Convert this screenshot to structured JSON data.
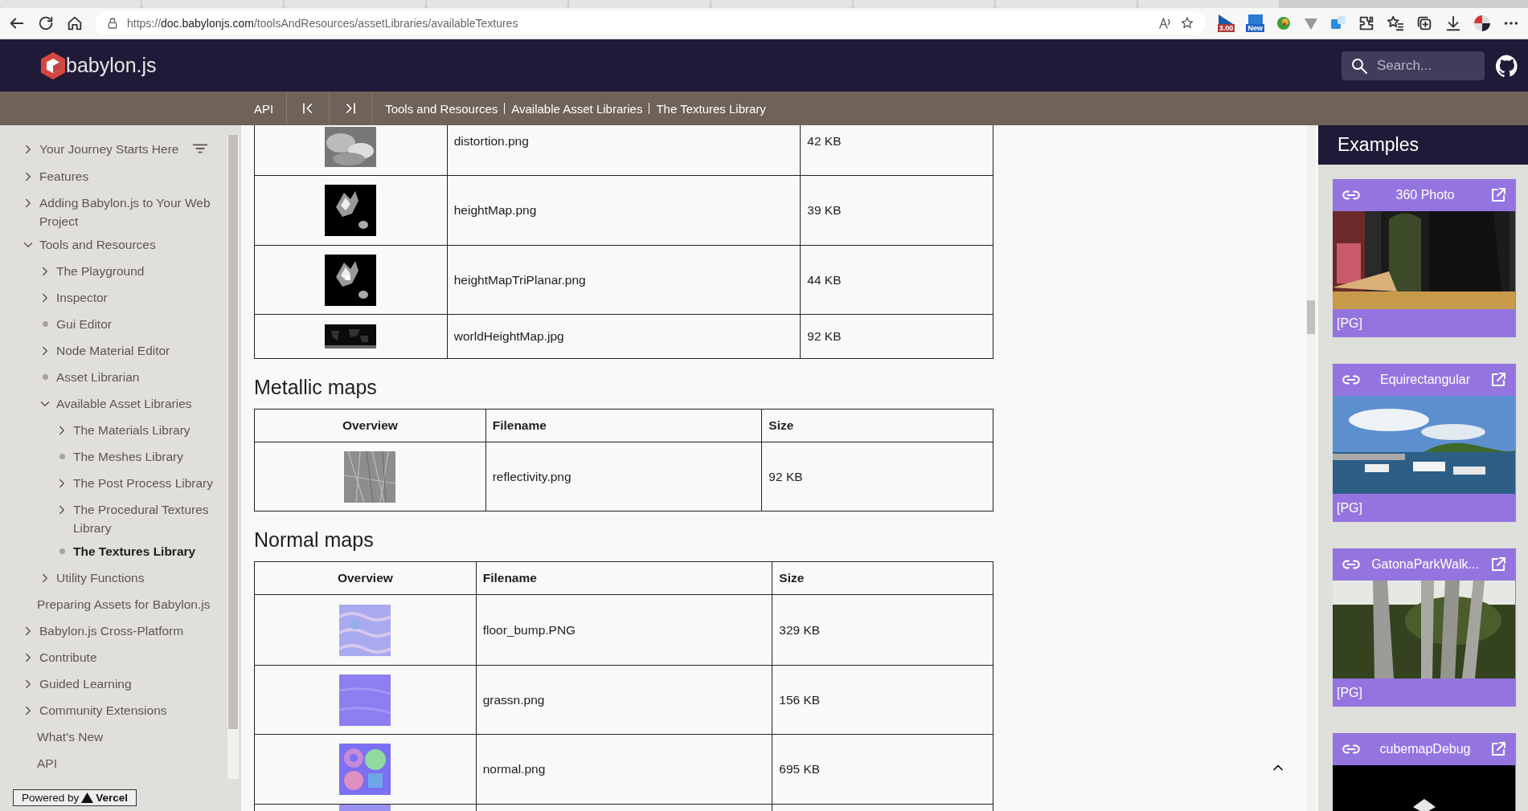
{
  "browser": {
    "url": "https://doc.babylonjs.com/toolsAndResources/assetLibraries/availableTextures",
    "extension_badges": [
      "3.00",
      "New"
    ]
  },
  "header": {
    "logo": "babylon.js",
    "search": {
      "placeholder": "Search..."
    }
  },
  "nav": {
    "api": "API",
    "breadcrumbs": [
      "Tools and Resources",
      "Available Asset Libraries",
      "The Textures Library"
    ]
  },
  "sidebar": {
    "items": [
      {
        "label": "Your Journey Starts Here",
        "kind": "folder",
        "expanded": false,
        "selected": false
      },
      {
        "label": "Features",
        "kind": "folder",
        "expanded": false,
        "selected": false
      },
      {
        "label": "Adding Babylon.js to Your Web Project",
        "kind": "folder",
        "expanded": false,
        "selected": false
      },
      {
        "label": "Tools and Resources",
        "kind": "folder",
        "expanded": true,
        "selected": false,
        "children": [
          {
            "label": "The Playground",
            "kind": "folder",
            "expanded": false,
            "selected": false
          },
          {
            "label": "Inspector",
            "kind": "folder",
            "expanded": false,
            "selected": false
          },
          {
            "label": "Gui Editor",
            "kind": "page",
            "selected": false
          },
          {
            "label": "Node Material Editor",
            "kind": "folder",
            "expanded": false,
            "selected": false
          },
          {
            "label": "Asset Librarian",
            "kind": "page",
            "selected": false
          },
          {
            "label": "Available Asset Libraries",
            "kind": "folder",
            "expanded": true,
            "selected": false,
            "children": [
              {
                "label": "The Materials Library",
                "kind": "folder",
                "expanded": false,
                "selected": false
              },
              {
                "label": "The Meshes Library",
                "kind": "page",
                "selected": false
              },
              {
                "label": "The Post Process Library",
                "kind": "folder",
                "expanded": false,
                "selected": false
              },
              {
                "label": "The Procedural Textures Library",
                "kind": "folder",
                "expanded": false,
                "selected": false
              },
              {
                "label": "The Textures Library",
                "kind": "page",
                "selected": true
              }
            ]
          },
          {
            "label": "Utility Functions",
            "kind": "folder",
            "expanded": false,
            "selected": false
          }
        ]
      },
      {
        "label": "Preparing Assets for Babylon.js",
        "kind": "plain",
        "selected": false
      },
      {
        "label": "Babylon.js Cross-Platform",
        "kind": "folder",
        "expanded": false,
        "selected": false
      },
      {
        "label": "Contribute",
        "kind": "folder",
        "expanded": false,
        "selected": false
      },
      {
        "label": "Guided Learning",
        "kind": "folder",
        "expanded": false,
        "selected": false
      },
      {
        "label": "Community Extensions",
        "kind": "folder",
        "expanded": false,
        "selected": false
      },
      {
        "label": "What's New",
        "kind": "plain",
        "selected": false
      },
      {
        "label": "API",
        "kind": "plain",
        "selected": false
      }
    ],
    "powered_by": {
      "text": "Powered by",
      "brand": "Vercel"
    }
  },
  "content": {
    "sections": [
      {
        "rows": [
          {
            "kind": "picture",
            "filename": "distortion.png",
            "size": "42 KB"
          },
          {
            "kind": "picture",
            "filename": "heightMap.png",
            "size": "39 KB"
          },
          {
            "kind": "picture",
            "filename": "heightMapTriPlanar.png",
            "size": "44 KB"
          },
          {
            "kind": "picture",
            "filename": "worldHeightMap.jpg",
            "size": "92 KB"
          }
        ]
      },
      {
        "heading": "Metallic maps",
        "columns": [
          "Overview",
          "Filename",
          "Size"
        ],
        "rows": [
          {
            "kind": "picture",
            "filename": "reflectivity.png",
            "size": "92 KB"
          }
        ]
      },
      {
        "heading": "Normal maps",
        "columns": [
          "Overview",
          "Filename",
          "Size"
        ],
        "rows": [
          {
            "kind": "picture",
            "filename": "floor_bump.PNG",
            "size": "329 KB"
          },
          {
            "kind": "picture",
            "filename": "grassn.png",
            "size": "156 KB"
          },
          {
            "kind": "picture",
            "filename": "normal.png",
            "size": "695 KB"
          },
          {
            "kind": "picture"
          }
        ]
      }
    ]
  },
  "examples": {
    "title": "Examples",
    "cards": [
      {
        "title": "360 Photo",
        "tag": "[PG]"
      },
      {
        "title": "Equirectangular",
        "tag": "[PG]"
      },
      {
        "title": "GatonaParkWalk...",
        "tag": "[PG]"
      },
      {
        "title": "cubemapDebug"
      }
    ]
  }
}
